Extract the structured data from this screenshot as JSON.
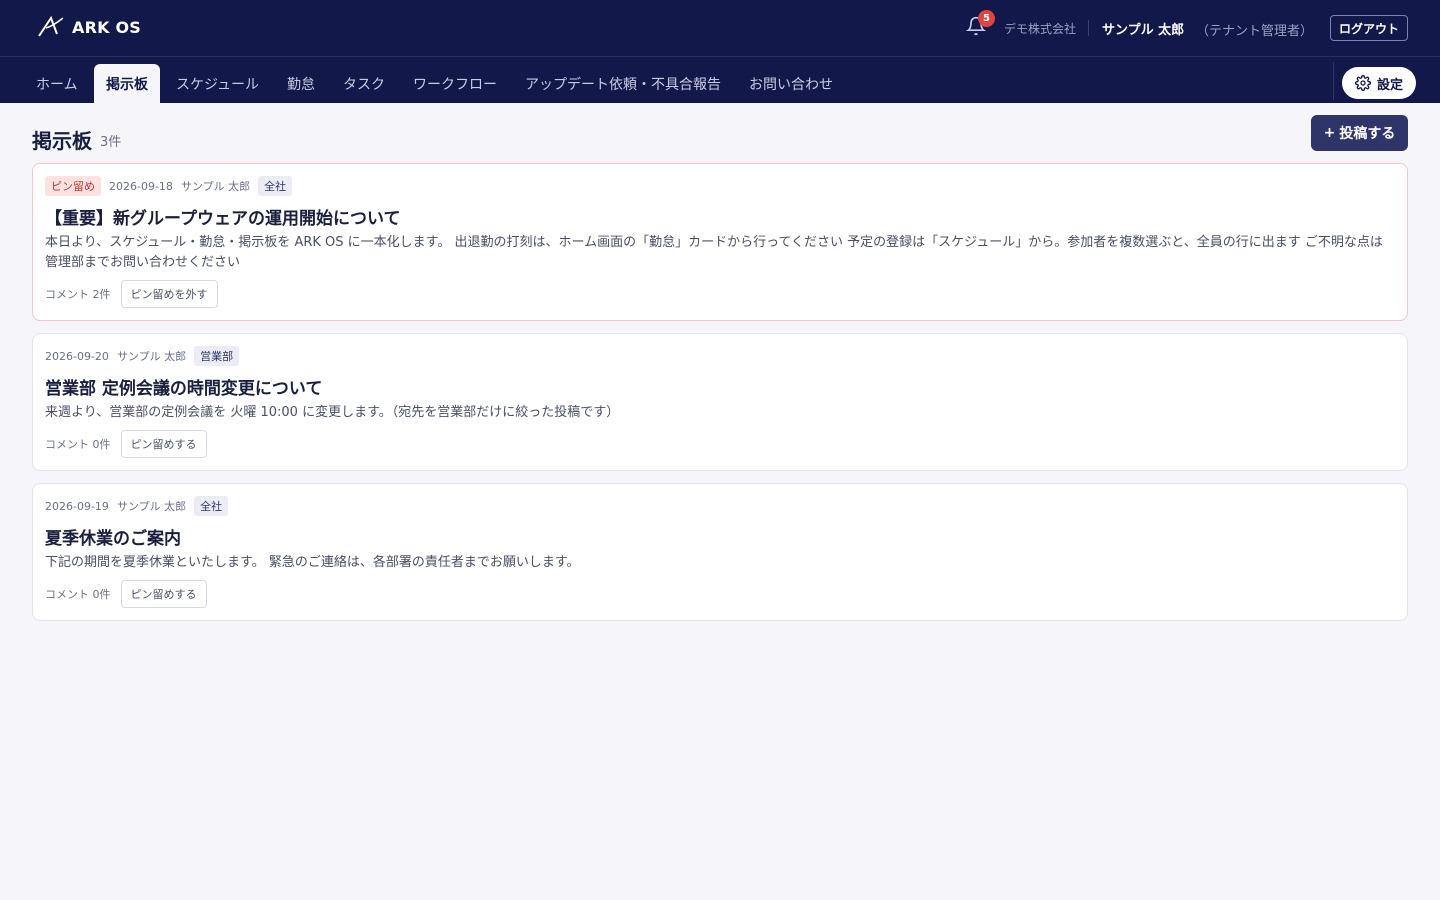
{
  "app": {
    "logo_text": "ARK OS",
    "notification_count": "5",
    "company": "デモ株式会社",
    "user_name": "サンプル 太郎",
    "user_role": "（テナント管理者）",
    "logout_label": "ログアウト"
  },
  "nav": {
    "tabs": [
      {
        "label": "ホーム"
      },
      {
        "label": "掲示板"
      },
      {
        "label": "スケジュール"
      },
      {
        "label": "勤怠"
      },
      {
        "label": "タスク"
      },
      {
        "label": "ワークフロー"
      },
      {
        "label": "アップデート依頼・不具合報告"
      },
      {
        "label": "お問い合わせ"
      }
    ],
    "active_tab": "掲示板",
    "settings_label": "設定"
  },
  "page": {
    "title": "掲示板",
    "count": "3件",
    "post_button": "投稿する"
  },
  "posts": [
    {
      "pinned": true,
      "pin_badge": "ピン留め",
      "date": "2026-09-18",
      "author": "サンプル 太郎",
      "scope": "全社",
      "title": "【重要】新グループウェアの運用開始について",
      "body": "本日より、スケジュール・勤怠・掲示板を ARK OS に一本化します。 出退勤の打刻は、ホーム画面の「勤怠」カードから行ってください 予定の登録は「スケジュール」から。参加者を複数選ぶと、全員の行に出ます ご不明な点は管理部までお問い合わせください",
      "comments": "コメント 2件",
      "pin_action": "ピン留めを外す"
    },
    {
      "pinned": false,
      "date": "2026-09-20",
      "author": "サンプル 太郎",
      "scope": "営業部",
      "title": "営業部 定例会議の時間変更について",
      "body": "来週より、営業部の定例会議を 火曜 10:00 に変更します。（宛先を営業部だけに絞った投稿です）",
      "comments": "コメント 0件",
      "pin_action": "ピン留めする"
    },
    {
      "pinned": false,
      "date": "2026-09-19",
      "author": "サンプル 太郎",
      "scope": "全社",
      "title": "夏季休業のご案内",
      "body": "下記の期間を夏季休業といたします。 緊急のご連絡は、各部署の責任者までお願いします。",
      "comments": "コメント 0件",
      "pin_action": "ピン留めする"
    }
  ],
  "colors": {
    "header_bg": "#12184a",
    "page_bg": "#f6f6fa",
    "primary_button": "#2f3568",
    "pin_badge_bg": "#fde2e2",
    "notification_badge": "#e0443e"
  }
}
